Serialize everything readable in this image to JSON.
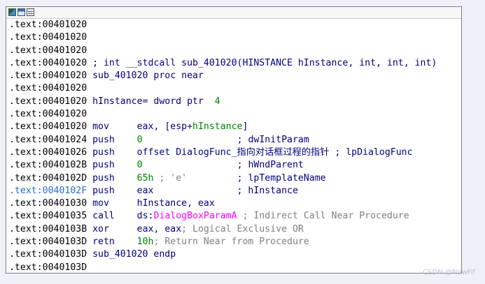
{
  "toolbar": {
    "icons": [
      "graph-view-icon",
      "proximity-view-icon",
      "text-view-icon"
    ]
  },
  "colors": {
    "address": "#000000",
    "address_highlight": "#2a6bd1",
    "code": "#000080",
    "comment": "#808080",
    "number": "#008000",
    "api_name": "#ff00ff"
  },
  "lines": [
    {
      "addr": ".text:00401020 "
    },
    {
      "addr": ".text:00401020 "
    },
    {
      "addr": ".text:00401020 "
    },
    {
      "addr": ".text:00401020 ",
      "comment": "; int __stdcall sub_401020(HINSTANCE hInstance, int, int, int)"
    },
    {
      "addr": ".text:00401020 ",
      "code": "sub_401020 proc near"
    },
    {
      "addr": ".text:00401020 "
    },
    {
      "addr": ".text:00401020 ",
      "code": "hInstance= dword ptr  ",
      "num": "4"
    },
    {
      "addr": ".text:00401020 "
    },
    {
      "addr": ".text:00401020 ",
      "mnem": "mov     ",
      "op": "eax, [esp+",
      "op_spec": "hInstance",
      "op_tail": "]"
    },
    {
      "addr": ".text:00401024 ",
      "mnem": "push    ",
      "num": "0",
      "pad": "                 ",
      "tail": "; dwInitParam"
    },
    {
      "addr": ".text:00401026 ",
      "mnem": "push    ",
      "op": "offset DialogFunc_指向对话框过程的指针 ",
      "tail": "; lpDialogFunc"
    },
    {
      "addr": ".text:0040102B ",
      "mnem": "push    ",
      "num": "0",
      "pad": "                 ",
      "tail": "; hWndParent"
    },
    {
      "addr": ".text:0040102D ",
      "mnem": "push    ",
      "num": "65h",
      "cm2": " ; 'e'",
      "pad": "         ",
      "tail": "; lpTemplateName"
    },
    {
      "addr": ".text:0040102F ",
      "highlight": true,
      "mnem": "push    ",
      "op": "eax",
      "pad": "               ",
      "tail": "; hInstance"
    },
    {
      "addr": ".text:00401030 ",
      "mnem": "mov     ",
      "op": "hInstance, eax"
    },
    {
      "addr": ".text:00401035 ",
      "mnem": "call    ",
      "op": "ds:",
      "api": "DialogBoxParamA",
      "cm2": " ; Indirect Call Near Procedure"
    },
    {
      "addr": ".text:0040103B ",
      "mnem": "xor     ",
      "op": "eax, eax",
      "pad": "          ",
      "cm2": "; Logical Exclusive OR"
    },
    {
      "addr": ".text:0040103D ",
      "mnem": "retn    ",
      "num": "10h",
      "pad": "               ",
      "cm2": "; Return Near from Procedure"
    },
    {
      "addr": ".text:0040103D ",
      "code": "sub_401020 endp"
    },
    {
      "addr": ".text:0040103D "
    }
  ],
  "watermark": "CSDN @NowFif"
}
